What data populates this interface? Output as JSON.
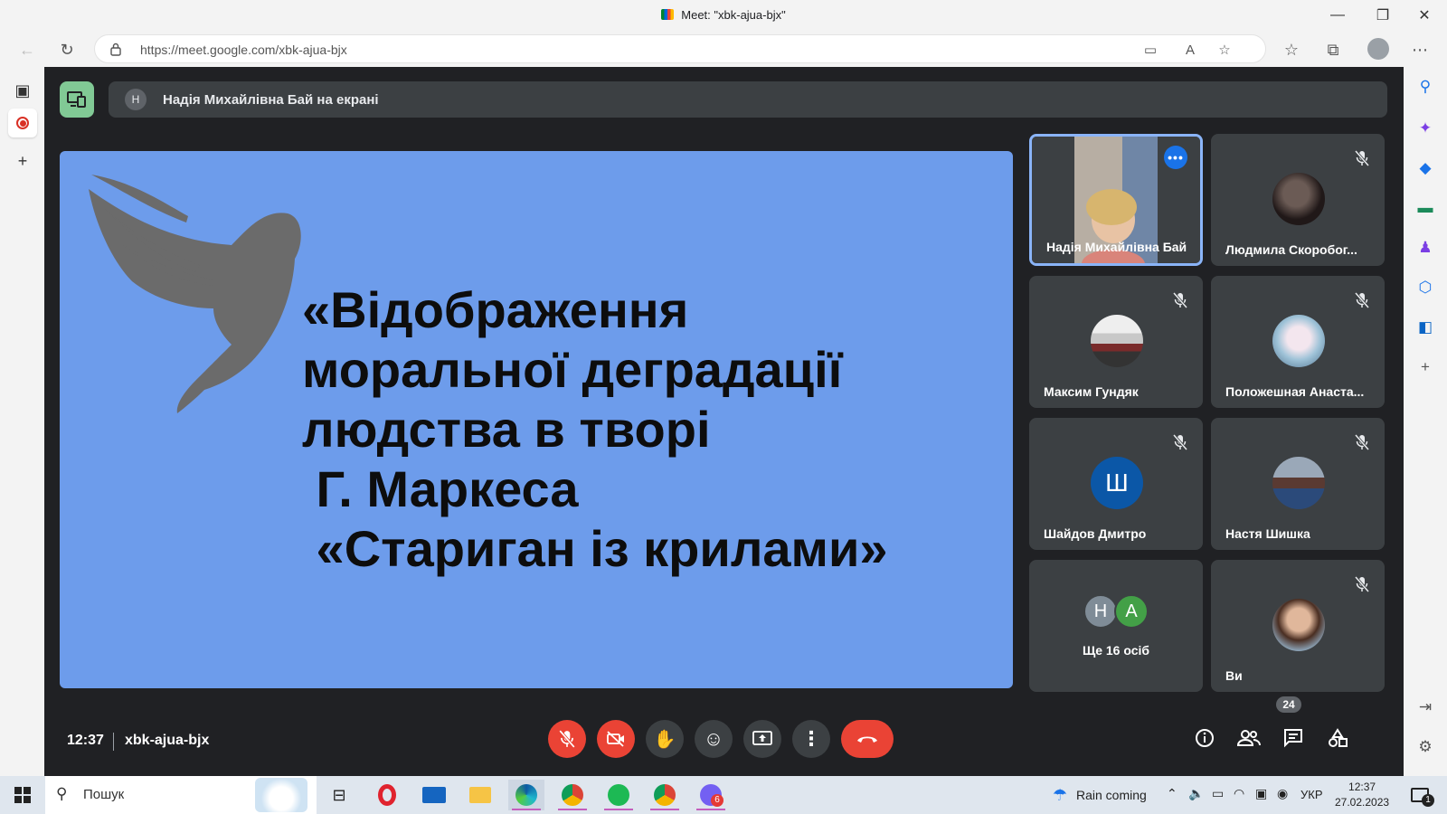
{
  "window": {
    "title": "Meet: \"xbk-ajua-bjx\""
  },
  "browser": {
    "url": "https://meet.google.com/xbk-ajua-bjx"
  },
  "meet": {
    "presenting_banner": "Надія Михайлівна Бай на екрані",
    "presenter_initial": "Н",
    "slide": {
      "lines": [
        "«Відображення",
        "моральної деградації",
        "людства в творі",
        " Г. Маркеса",
        " «Стариган із крилами»"
      ]
    },
    "participants": [
      {
        "name": "Надія Михайлівна Бай",
        "muted": false,
        "active": true
      },
      {
        "name": "Людмила Скоробог...",
        "muted": true
      },
      {
        "name": "Максим Гундяк",
        "muted": true
      },
      {
        "name": "Положешная Анаста...",
        "muted": true
      },
      {
        "name": "Шайдов Дмитро",
        "muted": true,
        "initial": "Ш"
      },
      {
        "name": "Настя Шишка",
        "muted": true
      },
      {
        "name": "Ще 16 осіб",
        "initials": [
          "Н",
          "А"
        ]
      },
      {
        "name": "Ви",
        "muted": true
      }
    ],
    "time": "12:37",
    "code": "xbk-ajua-bjx",
    "people_count": "24"
  },
  "taskbar": {
    "search_placeholder": "Пошук",
    "weather": "Rain coming",
    "language": "УКР",
    "time": "12:37",
    "date": "27.02.2023",
    "viber_badge": "6",
    "notification_count": "1"
  },
  "colors": {
    "meet_bg": "#202124",
    "tile_bg": "#3c4043",
    "slide_bg": "#6d9ceb",
    "hangup": "#ea4335",
    "accent": "#8ab4f8"
  }
}
